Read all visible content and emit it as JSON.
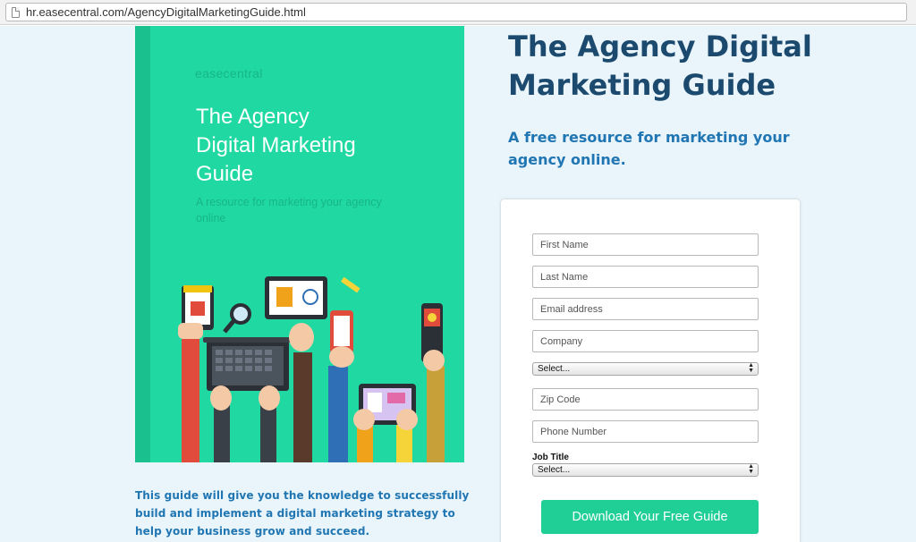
{
  "browser": {
    "url": "hr.easecentral.com/AgencyDigitalMarketingGuide.html"
  },
  "cover": {
    "brand": "easecentral",
    "title_lines": [
      "The Agency",
      "Digital Marketing",
      "Guide"
    ],
    "subtitle": "A resource for marketing your agency online",
    "illustration": "hands-holding-devices-illustration"
  },
  "hero": {
    "title_lines": [
      "The Agency Digital",
      "Marketing Guide"
    ],
    "subtitle": "A free resource for marketing your agency online."
  },
  "form": {
    "first_name_placeholder": "First Name",
    "last_name_placeholder": "Last Name",
    "email_placeholder": "Email address",
    "company_placeholder": "Company",
    "select_1_value": "Select...",
    "zip_placeholder": "Zip Code",
    "phone_placeholder": "Phone Number",
    "job_title_label": "Job Title",
    "job_title_value": "Select...",
    "submit_label": "Download Your Free Guide"
  },
  "description": "This guide will give you the knowledge to successfully build and implement a digital marketing strategy to help your business grow and succeed.",
  "colors": {
    "cover_bg": "#20d9a2",
    "heading": "#1b4a6e",
    "accent_text": "#2076b3",
    "cta": "#20cf95",
    "page_bg": "#e9f4fb"
  }
}
